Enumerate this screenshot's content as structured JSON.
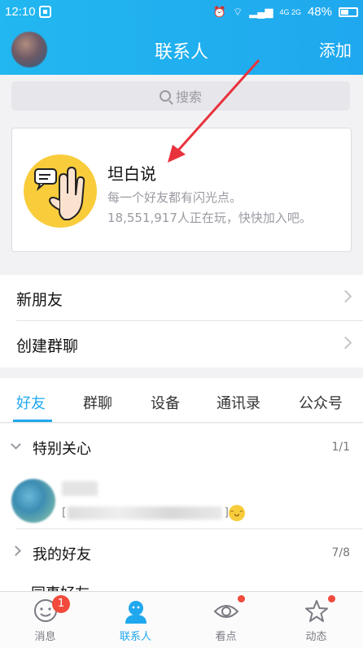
{
  "status_bar": {
    "time": "12:10",
    "network_label": "4G 2G",
    "battery": "48%"
  },
  "header": {
    "title": "联系人",
    "add_label": "添加"
  },
  "search": {
    "placeholder": "搜索"
  },
  "promo": {
    "title": "坦白说",
    "line1": "每一个好友都有闪光点。",
    "line2": "18,551,917人正在玩，快快加入吧。"
  },
  "menu": {
    "new_friends": "新朋友",
    "create_group": "创建群聊"
  },
  "tabs": [
    "好友",
    "群聊",
    "设备",
    "通讯录",
    "公众号"
  ],
  "groups": {
    "special": {
      "label": "特别关心",
      "count": "1/1"
    },
    "friends": {
      "label": "我的好友",
      "count": "7/8"
    },
    "next_partial": "同事好友"
  },
  "friend_row": {
    "status_prefix": "[",
    "status_suffix": "]"
  },
  "bottom_nav": {
    "messages": {
      "label": "消息",
      "badge": "1"
    },
    "contacts": {
      "label": "联系人"
    },
    "watch": {
      "label": "看点"
    },
    "feed": {
      "label": "动态"
    }
  },
  "colors": {
    "accent": "#1fa8ee",
    "badge": "#f04b3c",
    "promo_yellow": "#f9cc3c"
  }
}
